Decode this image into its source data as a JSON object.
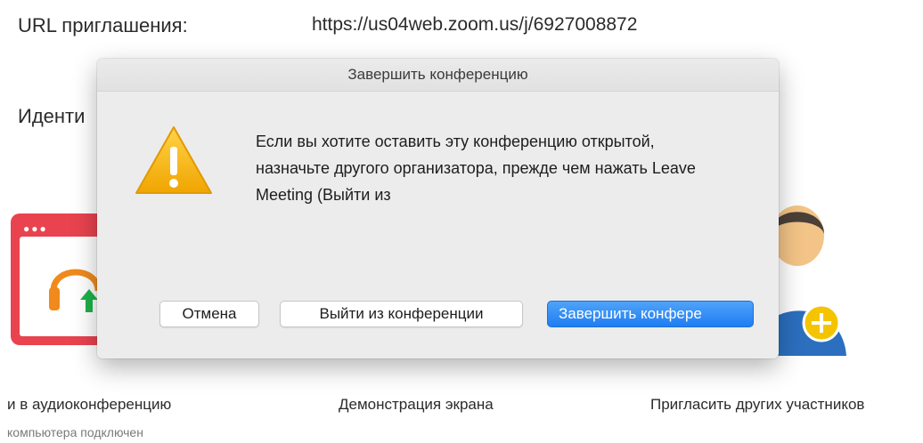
{
  "background": {
    "invite_url_label": "URL приглашения:",
    "invite_url_value": "https://us04web.zoom.us/j/6927008872",
    "meeting_id_label_partial": "Иденти",
    "audio_action_label": "и в аудиоконференцию",
    "audio_status": "компьютера подключен",
    "share_screen_label": "Демонстрация экрана",
    "invite_label": "Пригласить других участников"
  },
  "dialog": {
    "title": "Завершить конференцию",
    "message": "Если вы хотите оставить эту конференцию открытой, назначьте другого организатора, прежде чем нажать Leave Meeting (Выйти из",
    "buttons": {
      "cancel": "Отмена",
      "leave": "Выйти из конференции",
      "end": "Завершить конфере"
    }
  },
  "colors": {
    "primary_button": "#1f7df2",
    "warning": "#f5b400",
    "audio_icon": "#e8434f",
    "invite_plus": "#f5c400"
  }
}
